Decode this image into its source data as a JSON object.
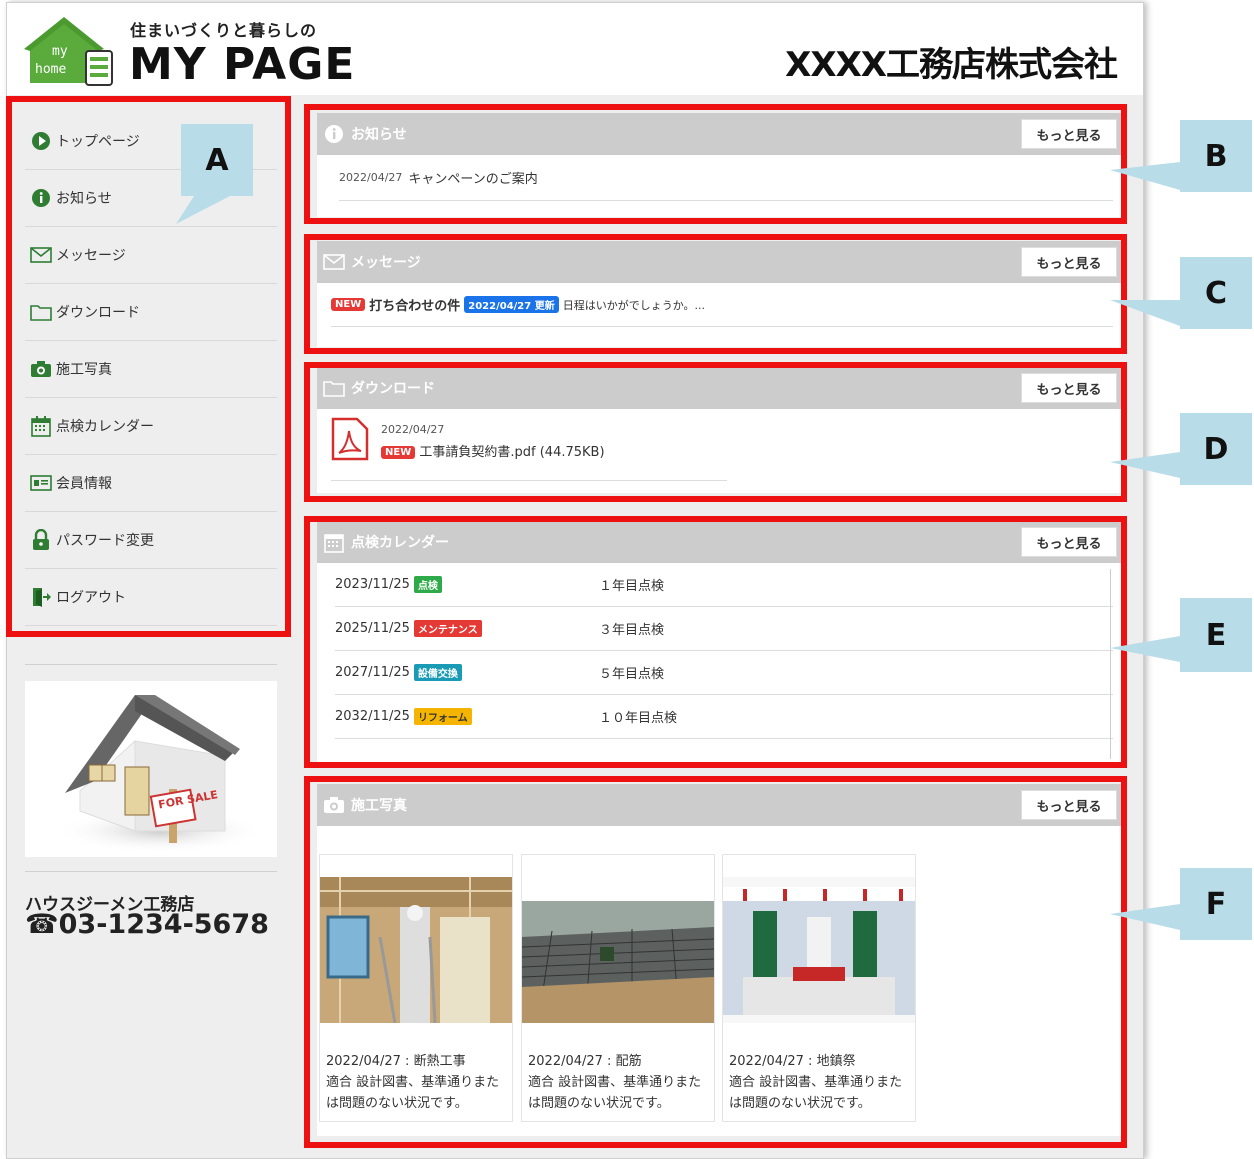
{
  "header": {
    "tagline": "住まいづくりと暮らしの",
    "title": "MY PAGE",
    "logo_line1": "my",
    "logo_line2": "home",
    "company": "XXXX工務店株式会社"
  },
  "sidebar": {
    "items": [
      {
        "label": "トップページ",
        "icon": "play-circle-icon"
      },
      {
        "label": "お知らせ",
        "icon": "info-icon"
      },
      {
        "label": "メッセージ",
        "icon": "envelope-icon"
      },
      {
        "label": "ダウンロード",
        "icon": "folder-icon"
      },
      {
        "label": "施工写真",
        "icon": "camera-icon"
      },
      {
        "label": "点検カレンダー",
        "icon": "calendar-icon"
      },
      {
        "label": "会員情報",
        "icon": "id-card-icon"
      },
      {
        "label": "パスワード変更",
        "icon": "lock-icon"
      },
      {
        "label": "ログアウト",
        "icon": "logout-icon"
      }
    ],
    "ad_sign": "FOR SALE",
    "shop_name": "ハウスジーメン工務店",
    "shop_tel": "03-1234-5678"
  },
  "more_label": "もっと見る",
  "news": {
    "title": "お知らせ",
    "items": [
      {
        "date": "2022/04/27",
        "text": "キャンペーンのご案内"
      }
    ]
  },
  "messages": {
    "title": "メッセージ",
    "items": [
      {
        "new": "NEW",
        "subject": "打ち合わせの件",
        "updated": "2022/04/27 更新",
        "preview": "日程はいかがでしょうか。..."
      }
    ]
  },
  "downloads": {
    "title": "ダウンロード",
    "items": [
      {
        "date": "2022/04/27",
        "new": "NEW",
        "file": "工事請負契約書.pdf (44.75KB)"
      }
    ]
  },
  "calendar": {
    "title": "点検カレンダー",
    "items": [
      {
        "date": "2023/11/25",
        "tag": "点検",
        "tag_color": "#2eaa4a",
        "text": "１年目点検"
      },
      {
        "date": "2025/11/25",
        "tag": "メンテナンス",
        "tag_color": "#e53935",
        "text": "３年目点検"
      },
      {
        "date": "2027/11/25",
        "tag": "設備交換",
        "tag_color": "#1a9bb5",
        "text": "５年目点検"
      },
      {
        "date": "2032/11/25",
        "tag": "リフォーム",
        "tag_color": "#f4b400",
        "text": "１０年目点検"
      }
    ]
  },
  "photos": {
    "title": "施工写真",
    "items": [
      {
        "caption": "2022/04/27 : 断熱工事",
        "desc": "適合 設計図書、基準通りまたは問題のない状況です。"
      },
      {
        "caption": "2022/04/27 : 配筋",
        "desc": "適合 設計図書、基準通りまたは問題のない状況です。"
      },
      {
        "caption": "2022/04/27 : 地鎮祭",
        "desc": "適合 設計図書、基準通りまたは問題のない状況です。"
      }
    ]
  },
  "callouts": {
    "a": "A",
    "b": "B",
    "c": "C",
    "d": "D",
    "e": "E",
    "f": "F"
  },
  "colors": {
    "annotation_red": "#ee1111",
    "callout_blue": "#b9dce9",
    "logo_green": "#5aaa3c",
    "panel_header": "#cccccc"
  }
}
